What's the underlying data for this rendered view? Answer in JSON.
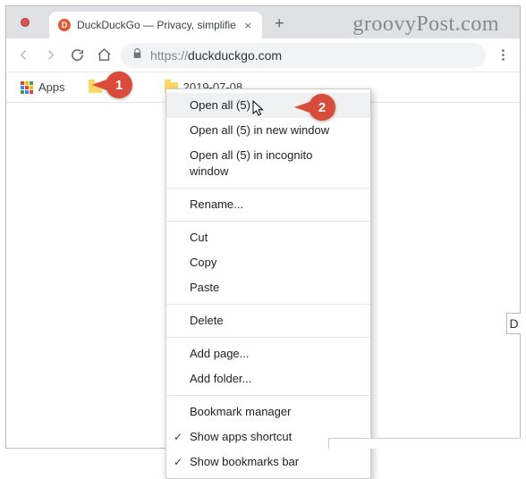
{
  "watermark": "groovyPost.com",
  "tab": {
    "title": "DuckDuckGo — Privacy, simplifie",
    "favicon_letter": "D"
  },
  "url": {
    "scheme": "https://",
    "host": "duckduckgo.com"
  },
  "bookmarks": {
    "apps_label": "Apps",
    "folder_label": "2019-07-08"
  },
  "context_menu": {
    "open_all": "Open all (5)",
    "open_all_new_window": "Open all (5) in new window",
    "open_all_incognito": "Open all (5) in incognito window",
    "rename": "Rename...",
    "cut": "Cut",
    "copy": "Copy",
    "paste": "Paste",
    "delete": "Delete",
    "add_page": "Add page...",
    "add_folder": "Add folder...",
    "bookmark_manager": "Bookmark manager",
    "show_apps": "Show apps shortcut",
    "show_bookmarks": "Show bookmarks bar"
  },
  "callouts": {
    "one": "1",
    "two": "2"
  },
  "side_letter": "D"
}
